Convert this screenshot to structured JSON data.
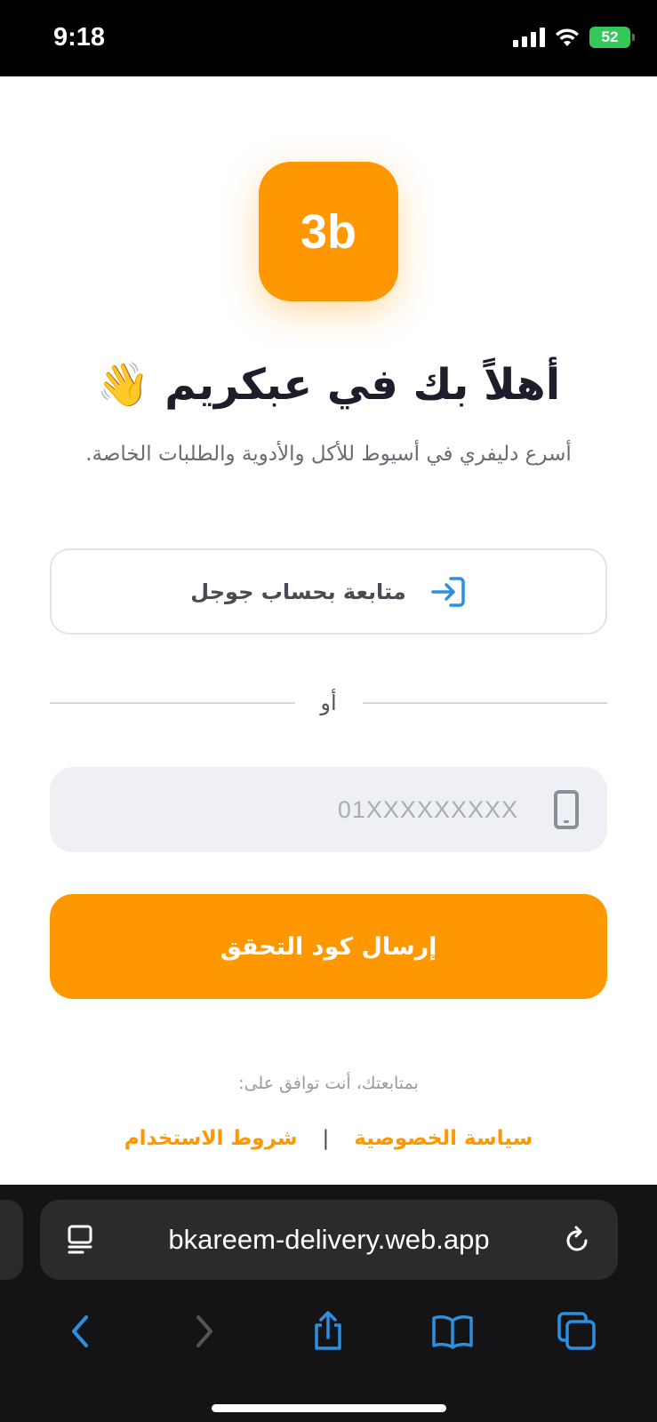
{
  "status": {
    "time": "9:18",
    "battery": "52"
  },
  "logo": {
    "text": "3b"
  },
  "welcome": {
    "title": "أهلاً بك في عبكريم 👋",
    "subtitle": "أسرع دليفري في أسيوط للأكل والأدوية والطلبات الخاصة."
  },
  "google_button": {
    "label": "متابعة بحساب جوجل",
    "icon": "sign-in-icon",
    "icon_color": "#2d8fe0"
  },
  "divider": {
    "text": "أو"
  },
  "phone": {
    "placeholder": "01XXXXXXXXX",
    "value": "",
    "icon": "mobile-phone-icon"
  },
  "send_button": {
    "label": "إرسال كود التحقق",
    "color": "#ff9800"
  },
  "terms": {
    "agree_text": "بمتابعتك، أنت توافق على:",
    "privacy_label": "سياسة الخصوصية",
    "separator": "|",
    "terms_label": "شروط الاستخدام"
  },
  "browser": {
    "url": "bkareem-delivery.web.app",
    "toolbar": [
      "back-icon",
      "forward-icon",
      "share-icon",
      "bookmarks-icon",
      "tabs-icon"
    ],
    "accent": "#2d8fe0"
  }
}
